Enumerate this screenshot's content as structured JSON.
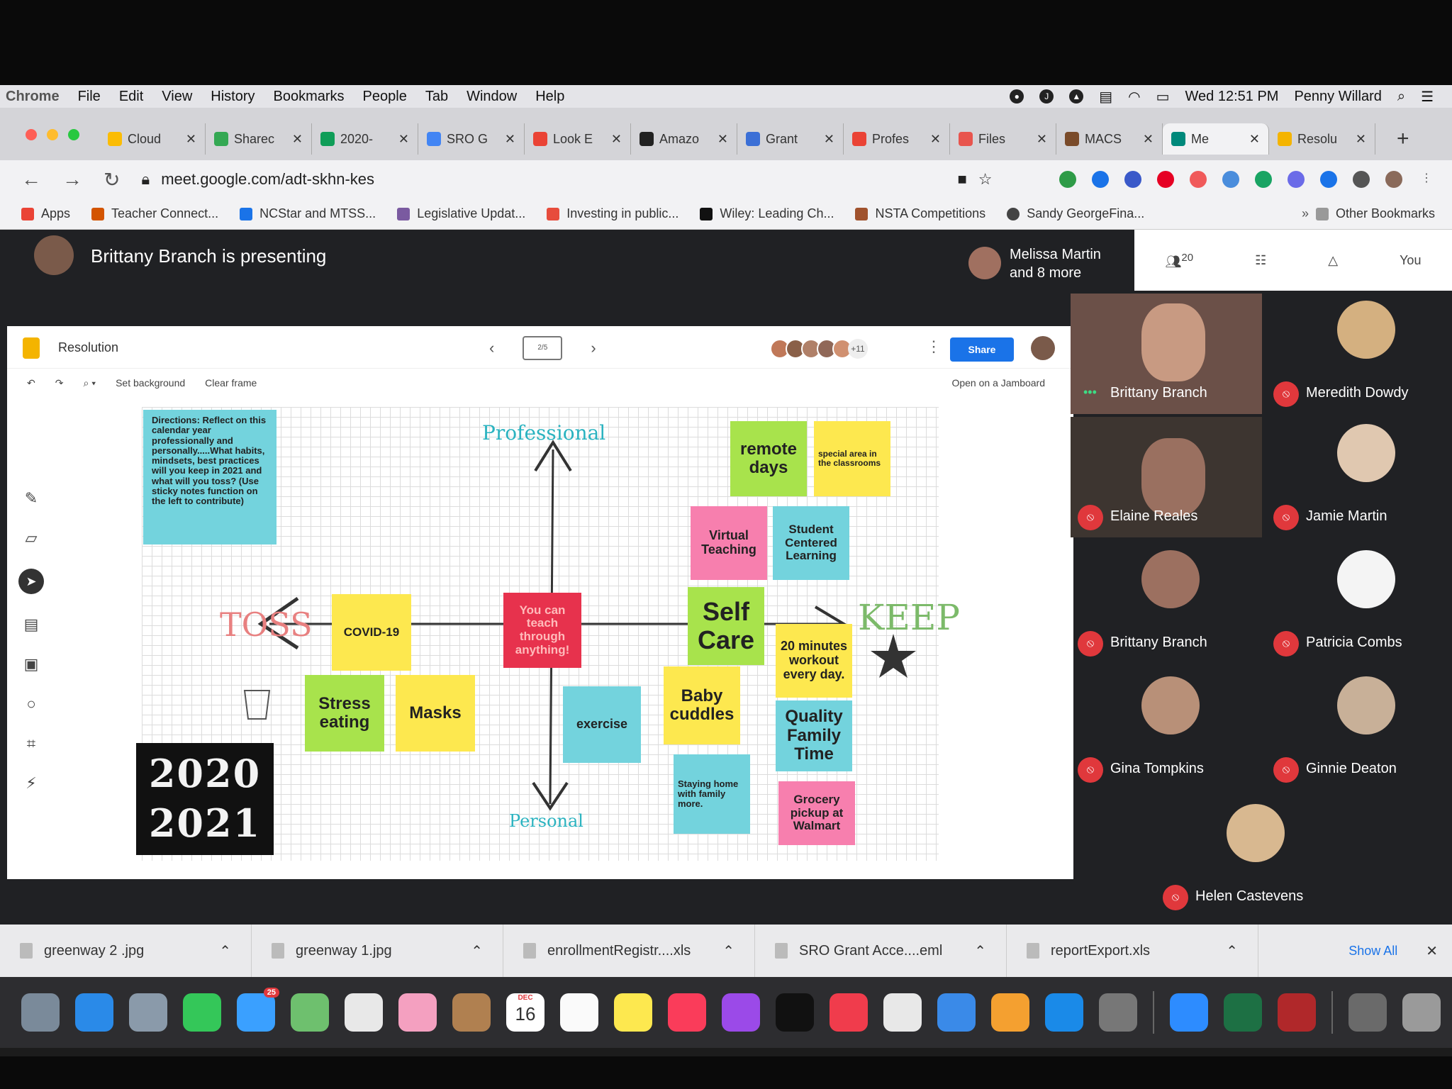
{
  "menubar": {
    "app": "Chrome",
    "items": [
      "File",
      "Edit",
      "View",
      "History",
      "Bookmarks",
      "People",
      "Tab",
      "Window",
      "Help"
    ],
    "clock": "Wed 12:51 PM",
    "user": "Penny Willard"
  },
  "tabs": [
    {
      "label": "Cloud",
      "color": "#fbbc04"
    },
    {
      "label": "Sharec",
      "color": "#34a853"
    },
    {
      "label": "2020-",
      "color": "#0f9d58"
    },
    {
      "label": "SRO G",
      "color": "#4285f4"
    },
    {
      "label": "Look E",
      "color": "#ea4335"
    },
    {
      "label": "Amazo",
      "color": "#222222"
    },
    {
      "label": "Grant",
      "color": "#3b6fd6"
    },
    {
      "label": "Profes",
      "color": "#ea4335"
    },
    {
      "label": "Files",
      "color": "#e8554e"
    },
    {
      "label": "MACS",
      "color": "#7a4b2a"
    },
    {
      "label": "Me",
      "color": "#00897b"
    },
    {
      "label": "Resolu",
      "color": "#f4b400"
    }
  ],
  "address": "meet.google.com/adt-skhn-kes",
  "bookmarks": [
    "Apps",
    "Teacher Connect...",
    "NCStar and MTSS...",
    "Legislative Updat...",
    "Investing in public...",
    "Wiley: Leading Ch...",
    "NSTA Competitions",
    "Sandy GeorgeFina..."
  ],
  "other_bookmarks": "Other Bookmarks",
  "meet": {
    "presenting": "Brittany Branch is presenting",
    "others": "Melissa Martin",
    "others_more": "and 8 more",
    "people_count": "20",
    "you": "You"
  },
  "jam": {
    "title": "Resolution",
    "frame": "2/5",
    "share": "Share",
    "collab_more": "+11",
    "set_background": "Set background",
    "clear_frame": "Clear frame",
    "open_on": "Open on a Jamboard",
    "directions": "Directions: Reflect on this calendar year professionally and personally.....What habits, mindsets, best practices will you keep in 2021 and what will you toss? (Use sticky notes function on the left to contribute)",
    "label_professional": "Professional",
    "label_personal": "Personal",
    "label_toss": "TOSS",
    "label_keep": "KEEP",
    "year_top": "2020",
    "year_bottom": "2021",
    "notes": {
      "remote": "remote days",
      "special": "special area in the classrooms",
      "virtual": "Virtual Teaching",
      "student": "Student Centered Learning",
      "selfcare": "Self Care",
      "covid": "COVID-19",
      "teach": "You can teach through anything!",
      "workout": "20 minutes workout every day.",
      "stress": "Stress eating",
      "masks": "Masks",
      "exercise": "exercise",
      "baby": "Baby cuddles",
      "quality": "Quality Family Time",
      "staying": "Staying home with family more.",
      "grocery": "Grocery pickup at Walmart"
    }
  },
  "participants": [
    {
      "name": "Brittany Branch"
    },
    {
      "name": "Meredith Dowdy"
    },
    {
      "name": "Elaine Reales"
    },
    {
      "name": "Jamie Martin"
    },
    {
      "name": "Brittany Branch"
    },
    {
      "name": "Patricia Combs"
    },
    {
      "name": "Gina Tompkins"
    },
    {
      "name": "Ginnie Deaton"
    },
    {
      "name": "Helen Castevens"
    }
  ],
  "downloads": [
    "greenway 2 .jpg",
    "greenway 1.jpg",
    "enrollmentRegistr....xls",
    "SRO Grant Acce....eml",
    "reportExport.xls"
  ],
  "show_all": "Show All",
  "dock_badges": {
    "messages": "25",
    "calendar_day": "16",
    "calendar_month": "DEC"
  }
}
